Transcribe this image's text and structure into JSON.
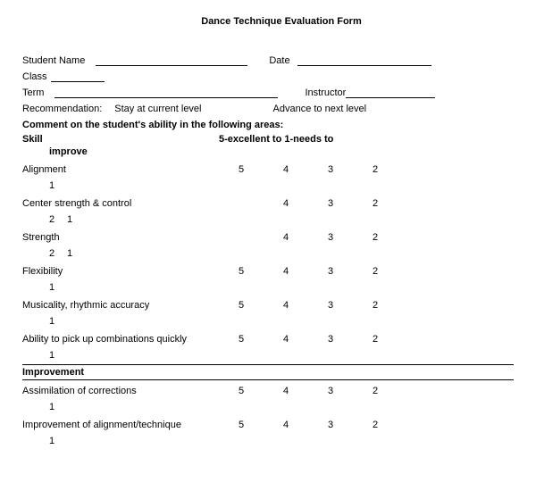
{
  "title": "Dance Technique Evaluation Form",
  "fields": {
    "student_name": "Student Name",
    "date": "Date",
    "class": "Class",
    "term": "Term",
    "instructor": "Instructor",
    "recommendation": "Recommendation:",
    "stay": "Stay at current level",
    "advance": "Advance to next level"
  },
  "comment_header": "Comment on the student's ability in the following areas:",
  "scale_label_left": "Skill",
  "scale_label_right": "5-excellent to 1-needs to",
  "scale_label_wrap": "improve",
  "ratings": [
    "5",
    "4",
    "3",
    "2",
    "1"
  ],
  "skills": [
    {
      "name": "Alignment",
      "cols": [
        true,
        true,
        true,
        true
      ],
      "wrap1": true
    },
    {
      "name": "Center strength & control",
      "cols": [
        false,
        true,
        true,
        true
      ],
      "wrap2": true
    },
    {
      "name": "Strength",
      "cols": [
        false,
        true,
        true,
        true
      ],
      "wrap2": true
    },
    {
      "name": "Flexibility",
      "cols": [
        true,
        true,
        true,
        true
      ],
      "wrap1": true
    },
    {
      "name": "Musicality, rhythmic accuracy",
      "cols": [
        true,
        true,
        true,
        true
      ],
      "wrap1": true
    },
    {
      "name": "Ability to pick up combinations quickly",
      "cols": [
        true,
        true,
        true,
        true
      ],
      "wrap1": true
    }
  ],
  "improvement_header": "Improvement",
  "improvement_skills": [
    {
      "name": "Assimilation of corrections",
      "cols": [
        true,
        true,
        true,
        true
      ],
      "wrap1": true
    },
    {
      "name": "Improvement of alignment/technique",
      "cols": [
        true,
        true,
        true,
        true
      ],
      "wrap1": true
    }
  ]
}
